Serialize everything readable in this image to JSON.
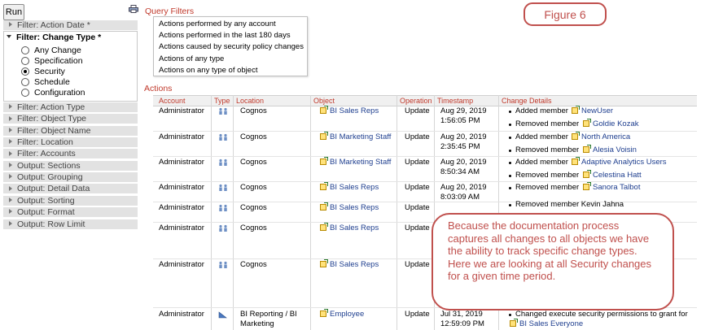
{
  "run_label": "Run",
  "sidebar": {
    "action_date": "Filter: Action Date *",
    "change_type": "Filter: Change Type *",
    "change_type_options": [
      {
        "label": "Any Change",
        "selected": false
      },
      {
        "label": "Specification",
        "selected": false
      },
      {
        "label": "Security",
        "selected": true
      },
      {
        "label": "Schedule",
        "selected": false
      },
      {
        "label": "Configuration",
        "selected": false
      }
    ],
    "sections": [
      "Filter: Action Type",
      "Filter: Object Type",
      "Filter: Object Name",
      "Filter: Location",
      "Filter: Accounts",
      "Output: Sections",
      "Output: Grouping",
      "Output: Detail Data",
      "Output: Sorting",
      "Output: Format",
      "Output: Row Limit"
    ]
  },
  "query_filters": {
    "title": "Query Filters",
    "items": [
      "Actions performed by any account",
      "Actions performed in the last 180 days",
      "Actions caused by security policy changes",
      "Actions of any type",
      "Actions on any type of object"
    ]
  },
  "figure_label": "Figure 6",
  "actions": {
    "title": "Actions",
    "columns": {
      "account": "Account",
      "type": "Type",
      "location": "Location",
      "object": "Object",
      "operation": "Operation",
      "timestamp": "Timestamp",
      "details": "Change Details"
    },
    "rows": [
      {
        "account": "Administrator",
        "location": "Cognos",
        "object": "BI Sales Reps",
        "operation": "Update",
        "ts1": "Aug 29, 2019",
        "ts2": "1:56:05 PM",
        "d1_action": "Added member",
        "d1_target": "NewUser",
        "d2_action": "Removed member",
        "d2_target": "Goldie Kozak"
      },
      {
        "account": "Administrator",
        "location": "Cognos",
        "object": "BI Marketing Staff",
        "operation": "Update",
        "ts1": "Aug 20, 2019",
        "ts2": "2:35:45 PM",
        "d1_action": "Added member",
        "d1_target": "North America",
        "d2_action": "Removed member",
        "d2_target": "Alesia Voisin"
      },
      {
        "account": "Administrator",
        "location": "Cognos",
        "object": "BI Marketing Staff",
        "operation": "Update",
        "ts1": "Aug 20, 2019",
        "ts2": "8:50:34 AM",
        "d1_action": "Added member",
        "d1_target": "Adaptive Analytics Users",
        "d2_action": "Removed member",
        "d2_target": "Celestina Hatt"
      },
      {
        "account": "Administrator",
        "location": "Cognos",
        "object": "BI Sales Reps",
        "operation": "Update",
        "ts1": "Aug 20, 2019",
        "ts2": "8:03:09 AM",
        "d1_action": "Removed member",
        "d1_target": "Sanora Talbot"
      },
      {
        "account": "Administrator",
        "location": "Cognos",
        "object": "BI Sales Reps",
        "operation": "Update",
        "partial": "Removed member Kevin Jahna"
      },
      {
        "account": "Administrator",
        "location": "Cognos",
        "object": "BI Sales Reps",
        "operation": "Update"
      },
      {
        "account": "Administrator",
        "location": "Cognos",
        "object": "BI Sales Reps",
        "operation": "Update"
      },
      {
        "account": "Administrator",
        "location1": "BI Reporting / BI",
        "location2": "Marketing",
        "object": "Employee",
        "operation": "Update",
        "ts1": "Jul 31, 2019",
        "ts2": "12:59:09 PM",
        "d1_action": "Changed execute security permissions to grant for",
        "d1_target": "BI Sales Everyone"
      }
    ]
  },
  "callout_text": "Because the documentation process captures all changes to all objects we have the ability to track specific change types. Here we are looking at all Security changes for a given time period.",
  "colors": {
    "accent_red": "#c0392b",
    "callout": "#c0504d",
    "link": "#1f3f8f"
  }
}
